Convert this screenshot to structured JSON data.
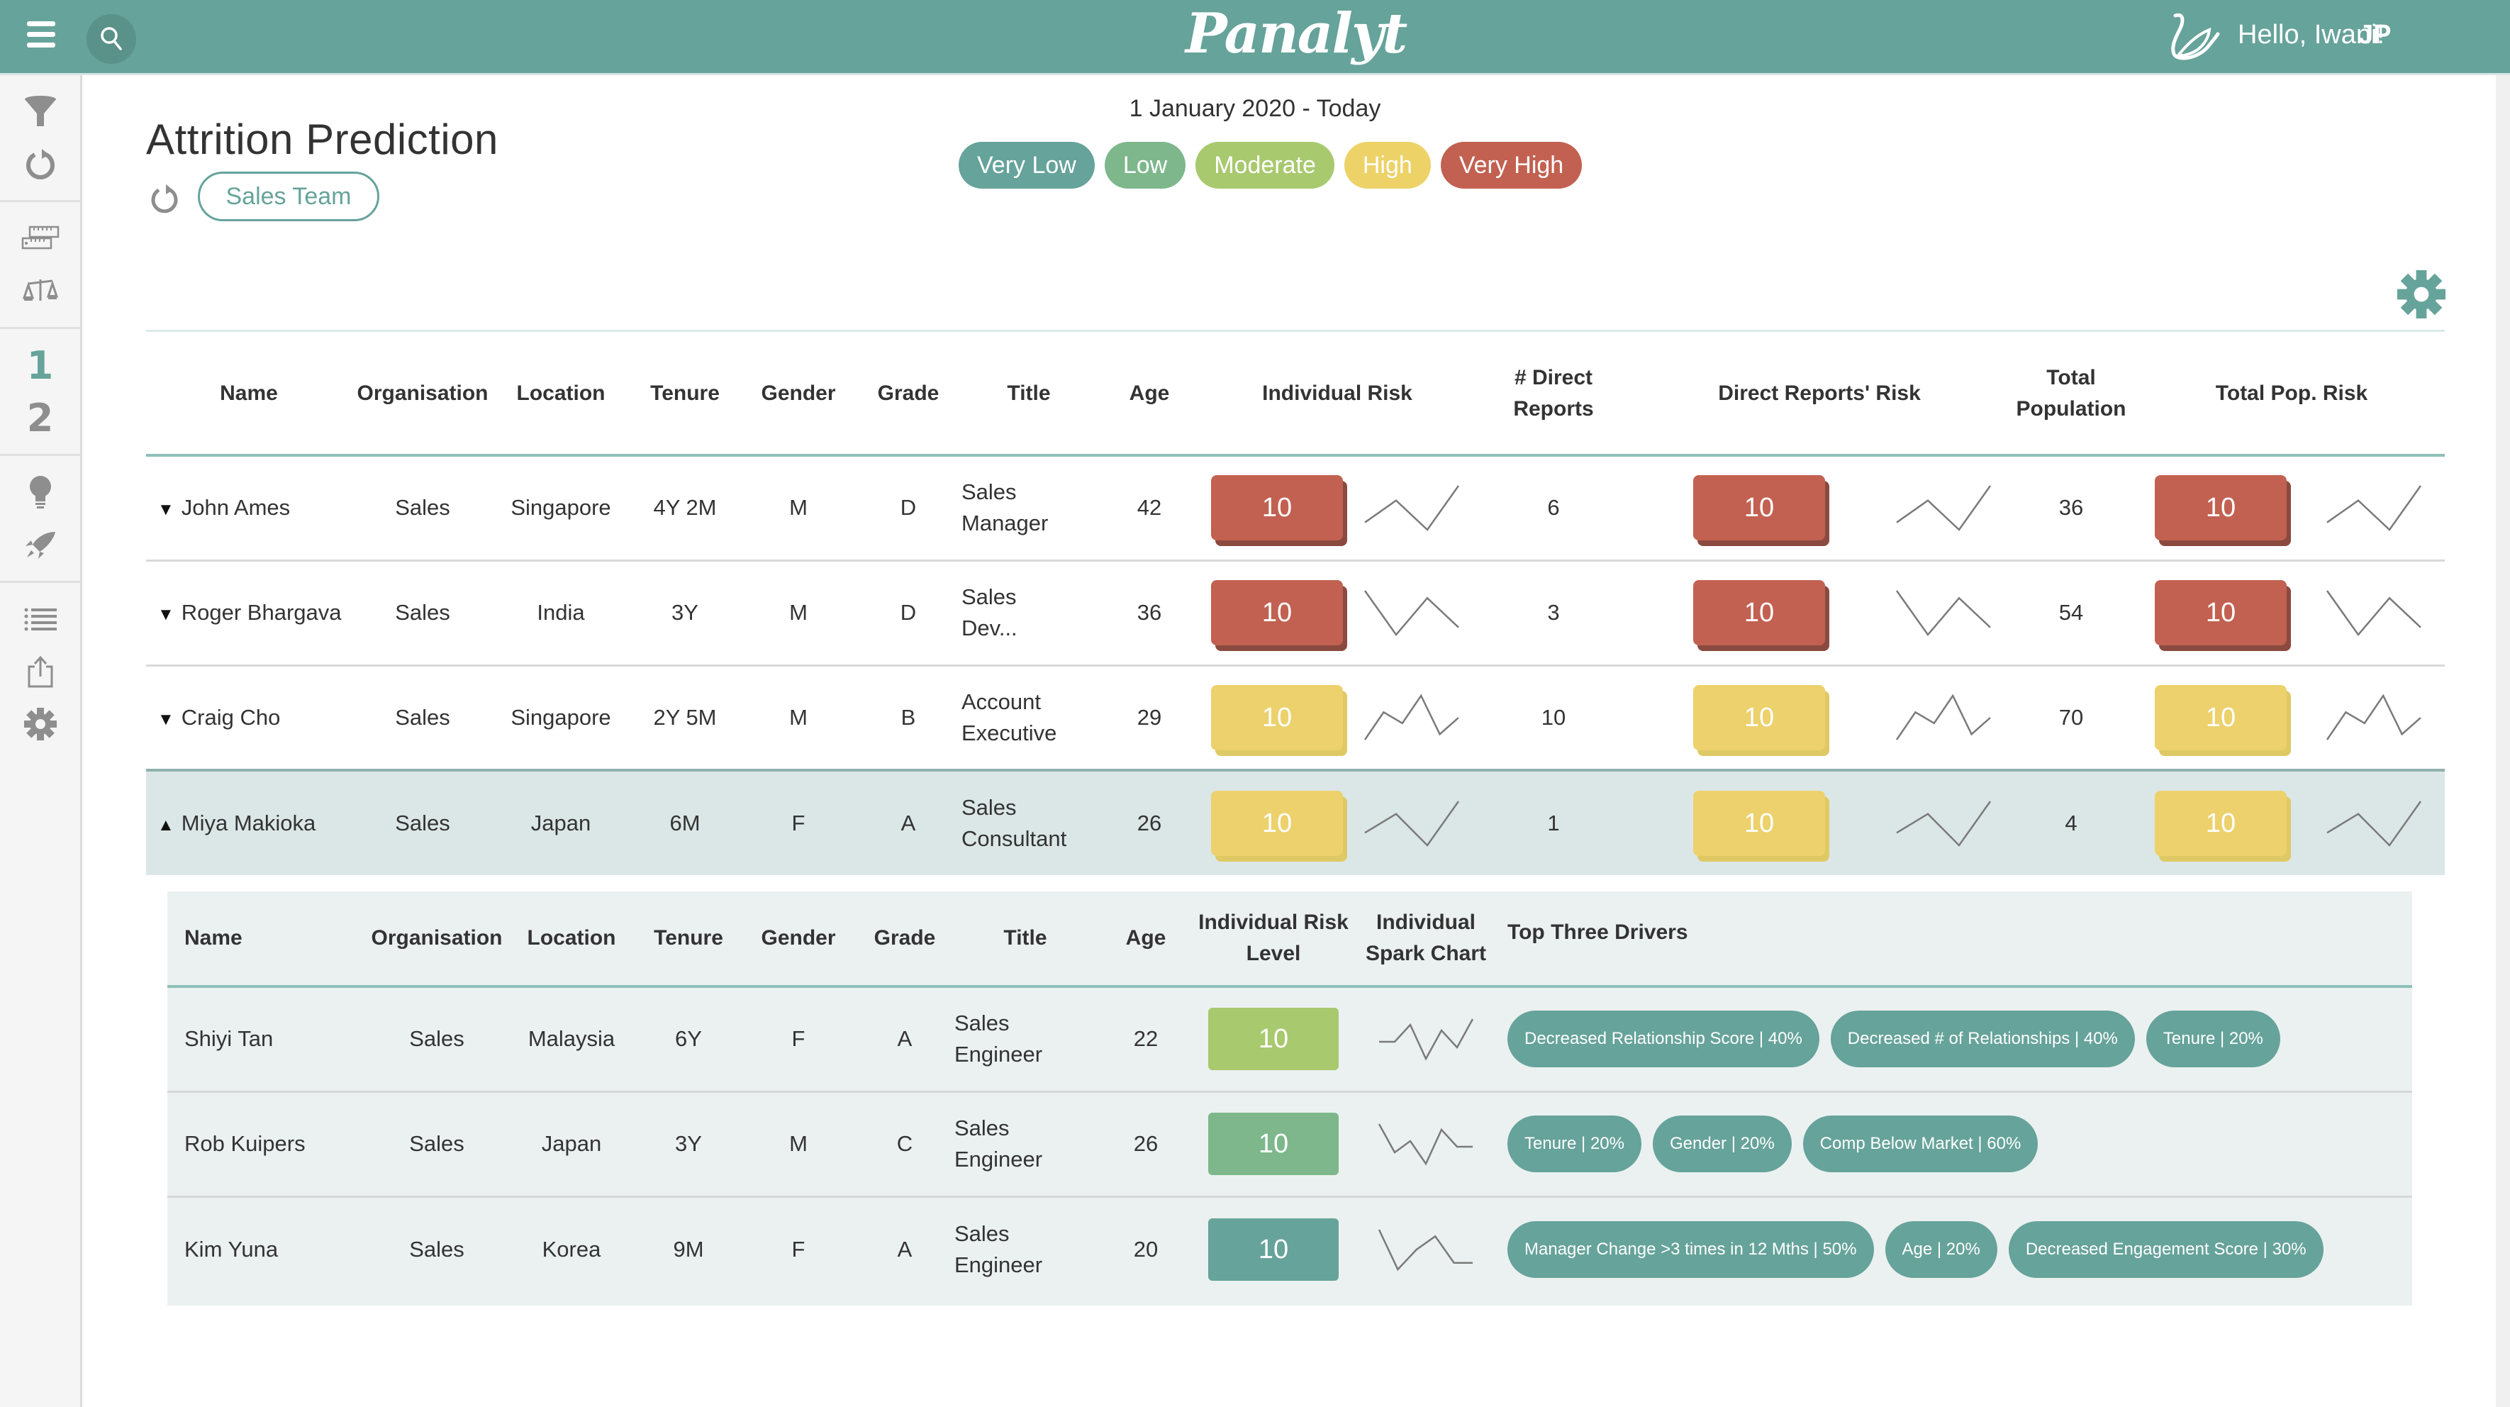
{
  "header": {
    "logo": "Panalyt",
    "greeting": "Hello, Iwani!",
    "initials": "JP"
  },
  "sidebar": {
    "groups": [
      [
        "filter-icon",
        "reset-icon"
      ],
      [
        "ruler-icon",
        "scales-icon"
      ],
      [
        "step-1",
        "step-2"
      ],
      [
        "lightbulb-icon",
        "rocket-icon"
      ],
      [
        "list-icon",
        "export-icon",
        "settings-icon"
      ]
    ],
    "step_labels": [
      "1",
      "2"
    ],
    "active_step": "1"
  },
  "page": {
    "title": "Attrition Prediction",
    "team_filter": "Sales Team",
    "date_range": "1 January 2020 - Today"
  },
  "legend": [
    {
      "label": "Very Low",
      "color": "#66a39a"
    },
    {
      "label": "Low",
      "color": "#7db78b"
    },
    {
      "label": "Moderate",
      "color": "#a8c96e"
    },
    {
      "label": "High",
      "color": "#edd268"
    },
    {
      "label": "Very High",
      "color": "#c26151"
    }
  ],
  "main_table": {
    "columns": [
      "Name",
      "Organisation",
      "Location",
      "Tenure",
      "Gender",
      "Grade",
      "Title",
      "Age",
      "Individual Risk",
      "# Direct Reports",
      "Direct Reports' Risk",
      "Total Population",
      "Total Pop. Risk"
    ],
    "rows": [
      {
        "name": "John Ames",
        "expanded": false,
        "org": "Sales",
        "location": "Singapore",
        "tenure": "4Y 2M",
        "gender": "M",
        "grade": "D",
        "title": [
          "Sales",
          "Manager"
        ],
        "age": "42",
        "individual_risk": "10",
        "direct_reports": "6",
        "direct_reports_risk": "10",
        "total_population": "36",
        "total_pop_risk": "10",
        "risk_level": "Very High",
        "spark": [
          3,
          6,
          2,
          8
        ]
      },
      {
        "name": "Roger Bhargava",
        "expanded": false,
        "org": "Sales",
        "location": "India",
        "tenure": "3Y",
        "gender": "M",
        "grade": "D",
        "title": [
          "Sales",
          "Dev..."
        ],
        "age": "36",
        "individual_risk": "10",
        "direct_reports": "3",
        "direct_reports_risk": "10",
        "total_population": "54",
        "total_pop_risk": "10",
        "risk_level": "Very High",
        "spark": [
          8,
          2,
          7,
          3
        ]
      },
      {
        "name": "Craig Cho",
        "expanded": false,
        "org": "Sales",
        "location": "Singapore",
        "tenure": "2Y 5M",
        "gender": "M",
        "grade": "B",
        "title": [
          "Account",
          "Executive"
        ],
        "age": "29",
        "individual_risk": "10",
        "direct_reports": "10",
        "direct_reports_risk": "10",
        "total_population": "70",
        "total_pop_risk": "10",
        "risk_level": "High",
        "spark": [
          1,
          6,
          4,
          9,
          2,
          5
        ]
      },
      {
        "name": "Miya Makioka",
        "expanded": true,
        "org": "Sales",
        "location": "Japan",
        "tenure": "6M",
        "gender": "F",
        "grade": "A",
        "title": [
          "Sales",
          "Consultant"
        ],
        "age": "26",
        "individual_risk": "10",
        "direct_reports": "1",
        "direct_reports_risk": "10",
        "total_population": "4",
        "total_pop_risk": "10",
        "risk_level": "High",
        "spark": [
          3,
          6,
          1,
          8
        ]
      }
    ]
  },
  "sub_table": {
    "columns": [
      "Name",
      "Organisation",
      "Location",
      "Tenure",
      "Gender",
      "Grade",
      "Title",
      "Age",
      "Individual Risk Level",
      "Individual Spark Chart",
      "Top Three Drivers"
    ],
    "rows": [
      {
        "name": "Shiyi Tan",
        "org": "Sales",
        "location": "Malaysia",
        "tenure": "6Y",
        "gender": "F",
        "grade": "A",
        "title": [
          "Sales",
          "Engineer"
        ],
        "age": "22",
        "risk": "10",
        "risk_level": "Moderate",
        "spark": [
          5,
          5,
          8,
          2,
          7,
          4,
          9
        ],
        "drivers": [
          "Decreased Relationship Score | 40%",
          "Decreased # of Relationships | 40%",
          "Tenure | 20%"
        ]
      },
      {
        "name": "Rob Kuipers",
        "org": "Sales",
        "location": "Japan",
        "tenure": "3Y",
        "gender": "M",
        "grade": "C",
        "title": [
          "Sales",
          "Engineer"
        ],
        "age": "26",
        "risk": "10",
        "risk_level": "Low",
        "spark": [
          9,
          4,
          6,
          2,
          8,
          5,
          5
        ],
        "drivers": [
          "Tenure | 20%",
          "Gender | 20%",
          "Comp Below Market | 60%"
        ]
      },
      {
        "name": "Kim Yuna",
        "org": "Sales",
        "location": "Korea",
        "tenure": "9M",
        "gender": "F",
        "grade": "A",
        "title": [
          "Sales",
          "Engineer"
        ],
        "age": "20",
        "risk": "10",
        "risk_level": "Very Low",
        "spark": [
          8,
          2,
          5,
          7,
          3,
          3
        ],
        "drivers": [
          "Manager Change >3 times in 12 Mths | 50%",
          "Age | 20%",
          "Decreased Engagement Score | 30%"
        ]
      }
    ]
  }
}
